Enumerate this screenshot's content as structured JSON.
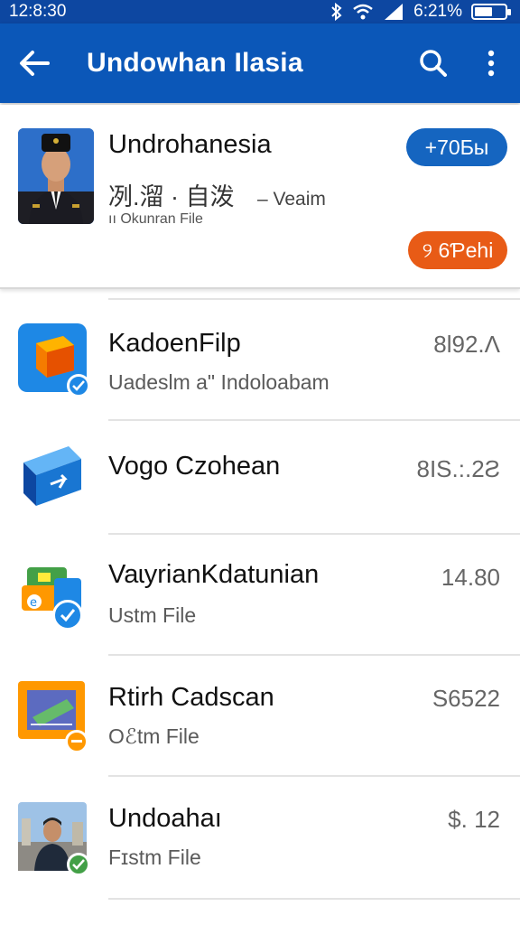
{
  "status_bar": {
    "time": "12:8:30",
    "battery_text": "6:21%",
    "battery_level": 0.6,
    "icons": [
      "bluetooth-icon",
      "wifi-icon",
      "signal-icon",
      "battery-icon"
    ]
  },
  "app_bar": {
    "title": "Undowhan Ilasia",
    "back_icon": "back-arrow-icon",
    "search_icon": "search-icon",
    "more_icon": "more-vert-icon"
  },
  "profile_card": {
    "name": "Undrohanesia",
    "subtitle": "冽.溜 · 自泼",
    "subtitle_suffix": "– Veaim",
    "meta": "ıı Okunran File",
    "badge_top": "+70Ƃы",
    "badge_bottom": "୨ 6Ƥehi",
    "colors": {
      "badge_top": "#1565c0",
      "badge_bottom": "#e85b16"
    }
  },
  "files": [
    {
      "name": "KadoenFilp",
      "detail": "Uadeslm a\" Indoloabam",
      "value": "8Ɩ92.Ʌ",
      "icon": "box-cube-icon",
      "badge": "check-icon"
    },
    {
      "name": "Vogo Czohean",
      "detail": "",
      "value": "8ΙS.:.2Ƨ",
      "icon": "blue-cube-icon",
      "badge": ""
    },
    {
      "name": "VaɩyrianKdatunian",
      "detail": "Ustm File",
      "value": "14.80",
      "icon": "stacked-boxes-icon",
      "badge": "check-icon"
    },
    {
      "name": "Rtirh Cadscan",
      "detail": "Oℰtm File",
      "value": "S6522",
      "icon": "document-chart-icon",
      "badge": "minus-icon"
    },
    {
      "name": "Undoahaı",
      "detail": "Fɪstm File",
      "value": "$. 12",
      "icon": "person-photo-icon",
      "badge": "check-icon"
    }
  ],
  "colors": {
    "app_bar": "#0b57b8",
    "status_bar": "#0d47a1",
    "accent_blue": "#1565c0",
    "accent_orange": "#e85b16"
  }
}
